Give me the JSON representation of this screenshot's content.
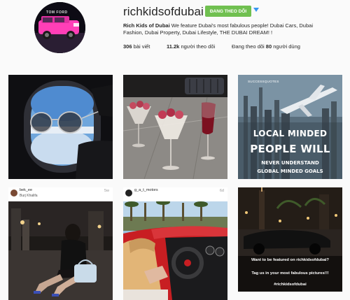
{
  "profile": {
    "username": "richkidsofdubai",
    "follow_button_label": "ĐANG THEO DÕI",
    "bio_name": "Rich Kids of Dubai",
    "bio_text": " We feature Dubai's most fabulous people! Dubai Cars, Dubai Fashion, Dubai Property, Dubai Lifestyle, THE DUBAI DREAM! !",
    "avatar_caption": "TOM FORD"
  },
  "stats": {
    "posts_count": "306",
    "posts_label": " bài viết",
    "followers_count": "11.2k",
    "followers_label": " người theo dõi",
    "following_prefix": "Đang theo dõi ",
    "following_count": "80",
    "following_suffix": " người dùng"
  },
  "posts": [
    {
      "id": "post-1",
      "kind": "airplane-window"
    },
    {
      "id": "post-2",
      "kind": "dessert-table"
    },
    {
      "id": "post-3",
      "kind": "quote",
      "watermark": "SUCCESSQUOTES",
      "lines": [
        "LOCAL MINDED",
        "PEOPLE WILL",
        "NEVER UNDERSTAND",
        "GLOBAL MINDED GOALS"
      ]
    },
    {
      "id": "post-4",
      "kind": "tagged",
      "user": "bek_ee",
      "location": "Burj Khalifa",
      "age": "5w"
    },
    {
      "id": "post-5",
      "kind": "tagged",
      "user": "g_a_t_motors",
      "location": "",
      "age": "6d"
    },
    {
      "id": "post-6",
      "kind": "promo",
      "lines": [
        "Want to be featured on richkidsofdubai?",
        "Tag us in your most fabulous pictures!!!",
        "#richkidsofdubai"
      ]
    }
  ],
  "colors": {
    "follow_button": "#70c050",
    "dropdown_arrow": "#3897f0",
    "page_background": "#fafafa"
  }
}
